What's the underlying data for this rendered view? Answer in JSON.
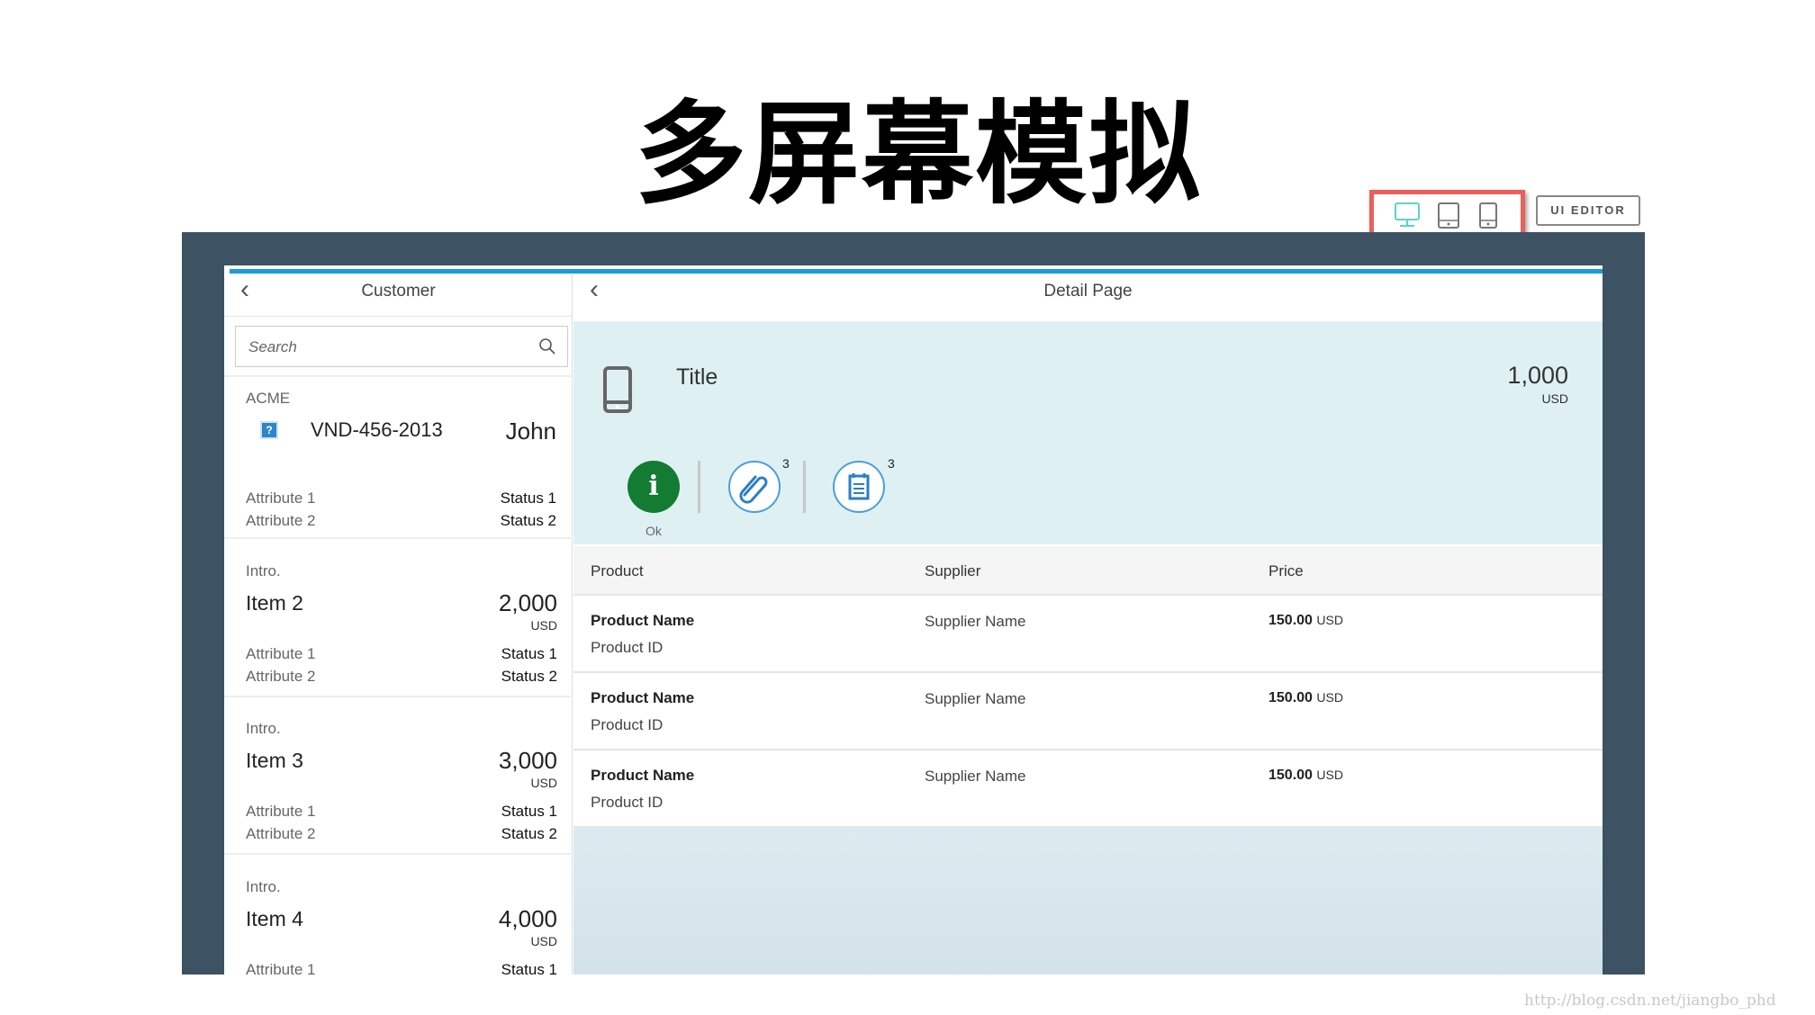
{
  "slide_title": "多屏幕模拟",
  "device_toggle": {
    "devices": [
      "desktop-icon",
      "tablet-icon",
      "phone-icon"
    ],
    "active": "desktop",
    "active_color": "#5fd3c4",
    "highlight_color": "#e8615a"
  },
  "ui_editor_label": "UI EDITOR",
  "master": {
    "title": "Customer",
    "search_placeholder": "Search",
    "first": {
      "intro": "ACME",
      "id": "VND-456-2013",
      "name": "John",
      "attr1": "Attribute 1",
      "attr2": "Attribute 2",
      "status1": "Status 1",
      "status2": "Status 2"
    },
    "items": [
      {
        "intro": "Intro.",
        "title": "Item 2",
        "number": "2,000",
        "unit": "USD",
        "attr1": "Attribute 1",
        "attr2": "Attribute 2",
        "status1": "Status 1",
        "status2": "Status 2"
      },
      {
        "intro": "Intro.",
        "title": "Item 3",
        "number": "3,000",
        "unit": "USD",
        "attr1": "Attribute 1",
        "attr2": "Attribute 2",
        "status1": "Status 1",
        "status2": "Status 2"
      },
      {
        "intro": "Intro.",
        "title": "Item 4",
        "number": "4,000",
        "unit": "USD",
        "attr1": "Attribute 1",
        "status1": "Status 1"
      }
    ]
  },
  "detail": {
    "title": "Detail Page",
    "object_title": "Title",
    "number": "1,000",
    "unit": "USD",
    "tabs": [
      {
        "icon": "info-icon",
        "label": "Ok",
        "color": "#137b32"
      },
      {
        "icon": "paperclip-icon",
        "count": "3"
      },
      {
        "icon": "notepad-icon",
        "count": "3"
      }
    ],
    "columns": [
      "Product",
      "Supplier",
      "Price"
    ],
    "rows": [
      {
        "name": "Product Name",
        "id": "Product ID",
        "supplier": "Supplier Name",
        "price": "150.00",
        "currency": "USD"
      },
      {
        "name": "Product Name",
        "id": "Product ID",
        "supplier": "Supplier Name",
        "price": "150.00",
        "currency": "USD"
      },
      {
        "name": "Product Name",
        "id": "Product ID",
        "supplier": "Supplier Name",
        "price": "150.00",
        "currency": "USD"
      }
    ]
  },
  "watermark": "http://blog.csdn.net/jiangbo_phd"
}
